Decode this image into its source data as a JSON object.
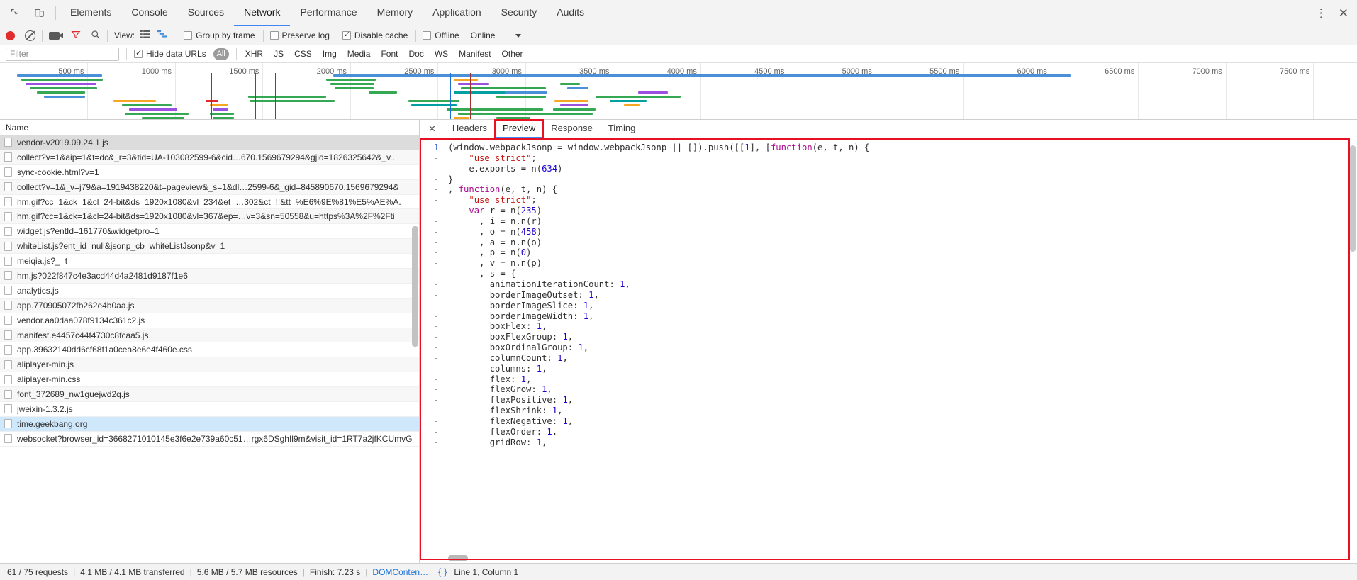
{
  "window": {
    "panel_tabs": [
      "Elements",
      "Console",
      "Sources",
      "Network",
      "Performance",
      "Memory",
      "Application",
      "Security",
      "Audits"
    ],
    "active_panel": "Network",
    "inspect_icon": "inspect-element-icon",
    "device_icon": "device-toolbar-icon",
    "kebab_icon": "more-options-icon",
    "close_icon": "close-devtools-icon"
  },
  "toolbar": {
    "record_icon": "record-button",
    "clear_icon": "clear-button",
    "capture_screenshots_icon": "camera-icon",
    "filter_icon": "filter-funnel-icon",
    "search_icon": "search-icon",
    "view_label": "View:",
    "view_list_icon": "list-view-icon",
    "view_waterfall_icon": "waterfall-view-icon",
    "group_by_frame": {
      "label": "Group by frame",
      "checked": false
    },
    "preserve_log": {
      "label": "Preserve log",
      "checked": false
    },
    "disable_cache": {
      "label": "Disable cache",
      "checked": true
    },
    "offline": {
      "label": "Offline",
      "checked": false
    },
    "throttling": {
      "value": "Online",
      "caret_icon": "chevron-down-icon"
    }
  },
  "filters": {
    "filter_placeholder": "Filter",
    "filter_value": "",
    "hide_data_urls": {
      "label": "Hide data URLs",
      "checked": true
    },
    "all_pill": "All",
    "types": [
      "XHR",
      "JS",
      "CSS",
      "Img",
      "Media",
      "Font",
      "Doc",
      "WS",
      "Manifest",
      "Other"
    ]
  },
  "overview": {
    "ticks": [
      "500 ms",
      "1000 ms",
      "1500 ms",
      "2000 ms",
      "2500 ms",
      "3000 ms",
      "3500 ms",
      "4000 ms",
      "4500 ms",
      "5000 ms",
      "5500 ms",
      "6000 ms",
      "6500 ms",
      "7000 ms",
      "7500 ms"
    ]
  },
  "requests": {
    "column_header": "Name",
    "items": [
      {
        "name": "vendor-v2019.09.24.1.js",
        "state": "top"
      },
      {
        "name": "collect?v=1&aip=1&t=dc&_r=3&tid=UA-103082599-6&cid…670.1569679294&gjid=1826325642&_v..",
        "state": ""
      },
      {
        "name": "sync-cookie.html?v=1",
        "state": ""
      },
      {
        "name": "collect?v=1&_v=j79&a=1919438220&t=pageview&_s=1&dl…2599-6&_gid=845890670.1569679294&",
        "state": ""
      },
      {
        "name": "hm.gif?cc=1&ck=1&cl=24-bit&ds=1920x1080&vl=234&et=…302&ct=!!&tt=%E6%9E%81%E5%AE%A.",
        "state": ""
      },
      {
        "name": "hm.gif?cc=1&ck=1&cl=24-bit&ds=1920x1080&vl=367&ep=…v=3&sn=50558&u=https%3A%2F%2Fti",
        "state": ""
      },
      {
        "name": "widget.js?entId=161770&widgetpro=1",
        "state": ""
      },
      {
        "name": "whiteList.js?ent_id=null&jsonp_cb=whiteListJsonp&v=1",
        "state": ""
      },
      {
        "name": "meiqia.js?_=t",
        "state": ""
      },
      {
        "name": "hm.js?022f847c4e3acd44d4a2481d9187f1e6",
        "state": ""
      },
      {
        "name": "analytics.js",
        "state": ""
      },
      {
        "name": "app.770905072fb262e4b0aa.js",
        "state": ""
      },
      {
        "name": "vendor.aa0daa078f9134c361c2.js",
        "state": ""
      },
      {
        "name": "manifest.e4457c44f4730c8fcaa5.js",
        "state": ""
      },
      {
        "name": "app.39632140dd6cf68f1a0cea8e6e4f460e.css",
        "state": ""
      },
      {
        "name": "aliplayer-min.js",
        "state": ""
      },
      {
        "name": "aliplayer-min.css",
        "state": ""
      },
      {
        "name": "font_372689_nw1guejwd2q.js",
        "state": ""
      },
      {
        "name": "jweixin-1.3.2.js",
        "state": ""
      },
      {
        "name": "time.geekbang.org",
        "state": "selected"
      },
      {
        "name": "websocket?browser_id=3668271010145e3f6e2e739a60c51…rgx6DSghIl9m&visit_id=1RT7a2jfKCUmvG",
        "state": ""
      }
    ]
  },
  "detail": {
    "close_icon": "close-detail-icon",
    "tabs": [
      "Headers",
      "Preview",
      "Response",
      "Timing"
    ],
    "active_tab": "Preview",
    "highlight_color": "#e81123",
    "first_line_number": "1",
    "code_lines": [
      "(window.webpackJsonp = window.webpackJsonp || []).push([[1], [function(e, t, n) {",
      "    \"use strict\";",
      "    e.exports = n(634)",
      "}",
      ", function(e, t, n) {",
      "    \"use strict\";",
      "    var r = n(235)",
      "      , i = n.n(r)",
      "      , o = n(458)",
      "      , a = n.n(o)",
      "      , p = n(0)",
      "      , v = n.n(p)",
      "      , s = {",
      "        animationIterationCount: 1,",
      "        borderImageOutset: 1,",
      "        borderImageSlice: 1,",
      "        borderImageWidth: 1,",
      "        boxFlex: 1,",
      "        boxFlexGroup: 1,",
      "        boxOrdinalGroup: 1,",
      "        columnCount: 1,",
      "        columns: 1,",
      "        flex: 1,",
      "        flexGrow: 1,",
      "        flexPositive: 1,",
      "        flexShrink: 1,",
      "        flexNegative: 1,",
      "        flexOrder: 1,",
      "        gridRow: 1,"
    ]
  },
  "statusbar": {
    "requests": "61 / 75 requests",
    "transferred": "4.1 MB / 4.1 MB transferred",
    "resources": "5.6 MB / 5.7 MB resources",
    "finish": "Finish: 7.23 s",
    "domcontent": "DOMConten…",
    "format_icon": "pretty-print-braces-icon",
    "cursor_position": "Line 1, Column 1"
  }
}
